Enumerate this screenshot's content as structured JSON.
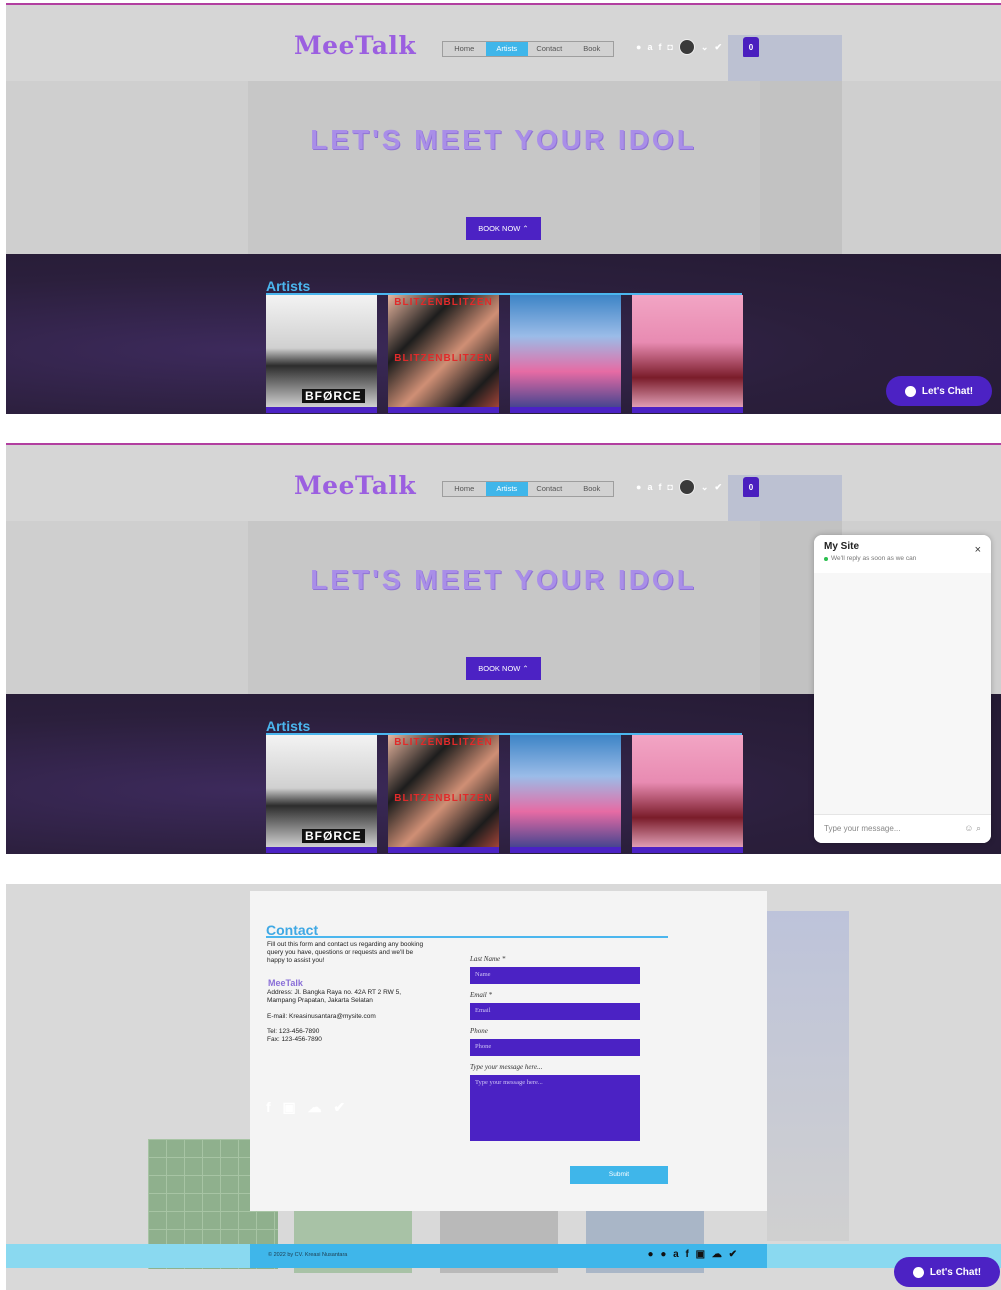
{
  "site": {
    "logo": "MeeTalk",
    "nav": [
      "Home",
      "Artists",
      "Contact",
      "Book"
    ],
    "active_nav": "Artists",
    "cart_count": "0",
    "hero_title": "LET'S MEET YOUR IDOL",
    "book_now": "BOOK NOW ⌃",
    "artists_title": "Artists",
    "thumb_labels": {
      "bforce": "BFØRCE",
      "blitzen1": "BLITZENBLITZEN",
      "blitzen2": "BLITZENBLITZEN"
    },
    "social_icons": [
      "spotify-icon",
      "amazon-icon",
      "facebook-icon",
      "instagram-icon",
      "avatar",
      "chevron-down-icon",
      "twitter-icon"
    ]
  },
  "chat": {
    "button_label": "Let's Chat!",
    "panel_title": "My Site",
    "status": "We'll reply as soon as we can",
    "close": "×",
    "placeholder": "Type your message...",
    "icons": "☺ ⌕"
  },
  "contact": {
    "title": "Contact",
    "intro": "Fill out this form and contact us regarding any booking query you have, questions or requests and we'll be happy to assist you!",
    "brand": "MeeTalk",
    "address": "Address: Jl. Bangka Raya no. 42A RT 2 RW 5, Mampang Prapatan, Jakarta Selatan",
    "email": "E-mail: Kreasinusantara@mysite.com",
    "tel": "Tel: 123-456-7890",
    "fax": "Fax: 123-456-7890",
    "social": "f ▣ ☁ ✔",
    "form": {
      "last_name_label": "Last Name *",
      "name_placeholder": "Name",
      "email_label": "Email *",
      "email_placeholder": "Email",
      "phone_label": "Phone",
      "phone_placeholder": "Phone",
      "message_label": "Type your message here...",
      "message_placeholder": "Type your message here...",
      "submit": "Submit"
    }
  },
  "footer": {
    "copyright": "© 2022 by CV. Kreasi Nusantara",
    "social": "● ● a f ▣ ☁ ✔"
  },
  "colors": {
    "accent_purple": "#4c22c4",
    "accent_blue": "#3fb6ea",
    "logo_purple": "#9b5fe0"
  }
}
